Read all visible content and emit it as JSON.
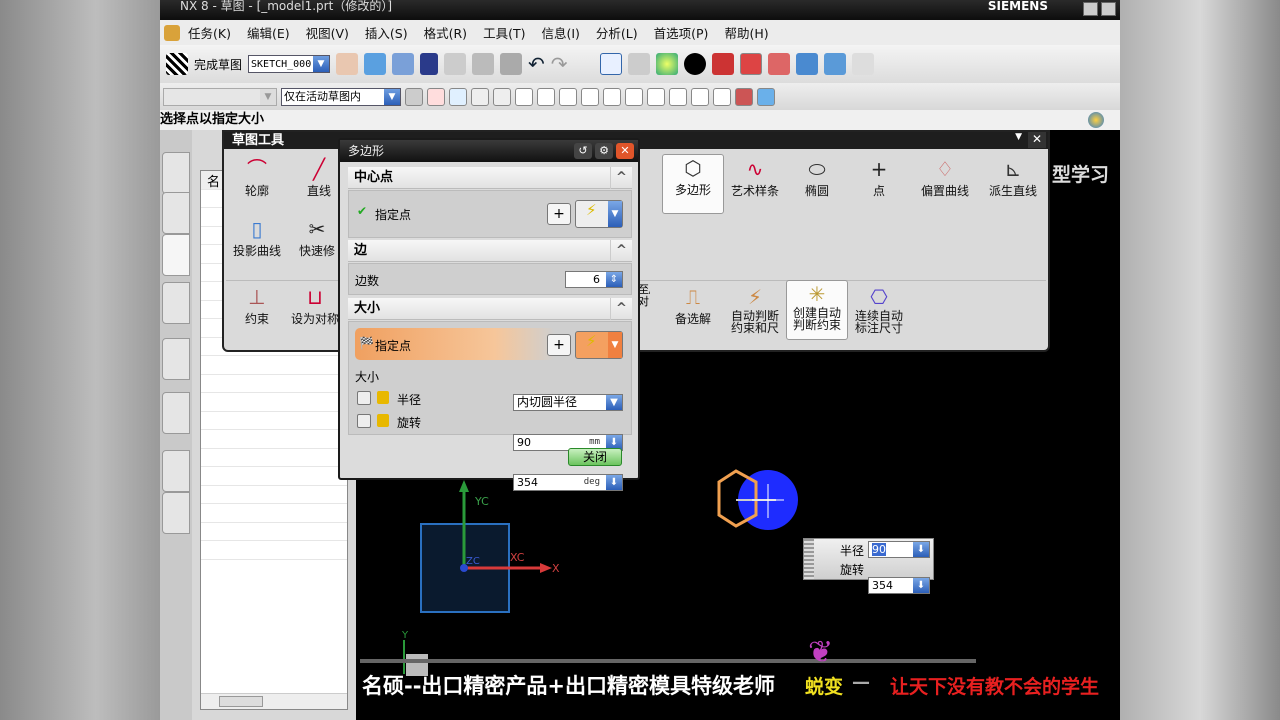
{
  "window": {
    "title": "NX 8 - 草图 - [_model1.prt（修改的）]",
    "brand": "SIEMENS"
  },
  "menu": [
    "任务(K)",
    "编辑(E)",
    "视图(V)",
    "插入(S)",
    "格式(R)",
    "工具(T)",
    "信息(I)",
    "分析(L)",
    "首选项(P)",
    "帮助(H)"
  ],
  "toolbar": {
    "finish_sketch": "完成草图",
    "sketch_name": "SKETCH_000",
    "filter_scope": "仅在活动草图内"
  },
  "cue_line": "选择点以指定大小",
  "navigator": {
    "column_header": "名"
  },
  "sketch_tools": {
    "title": "草图工具",
    "row1_left": [
      "轮廓",
      "直线"
    ],
    "row1_right": [
      "多边形",
      "艺术样条",
      "椭圆",
      "点",
      "偏置曲线",
      "派生直线"
    ],
    "row2_left": [
      "投影曲线",
      "快速修"
    ],
    "row3_left": [
      "约束",
      "设为对称"
    ],
    "row3_right": [
      "备选解",
      "自动判断约束和尺",
      "创建自动判断约束",
      "连续自动标注尺寸"
    ],
    "selected_tool": "多边形",
    "partial_label": "至/对"
  },
  "polygon_dialog": {
    "title": "多边形",
    "center_section": "中心点",
    "center_point_label": "指定点",
    "sides_section": "边",
    "sides_label": "边数",
    "sides_value": "6",
    "size_section": "大小",
    "size_point_label": "指定点",
    "size_label": "大小",
    "size_mode": "内切圆半径",
    "radius_label": "半径",
    "radius_value": "90",
    "radius_unit": "mm",
    "rotation_label": "旋转",
    "rotation_value": "354",
    "rotation_unit": "deg",
    "close_button": "关闭"
  },
  "graphics": {
    "axis_labels": {
      "yc": "YC",
      "xc": "XC",
      "zc": "ZC",
      "x": "X",
      "y": "Y"
    },
    "dynamic_input": {
      "radius_label": "半径",
      "radius_value": "90",
      "rotation_label": "旋转",
      "rotation_value": "354"
    },
    "partial_watermark": "型学习"
  },
  "subtitles": {
    "left": "名硕--出口精密产品+出口精密模具特级老师",
    "brand": "蜕变",
    "dash": "—",
    "right": "让天下没有教不会的学生"
  },
  "colors": {
    "accent_orange": "#f0a060",
    "hexagon": "#f0a050",
    "highlight_circle": "#1e2cff",
    "selection_blue": "#2c5fb8"
  }
}
